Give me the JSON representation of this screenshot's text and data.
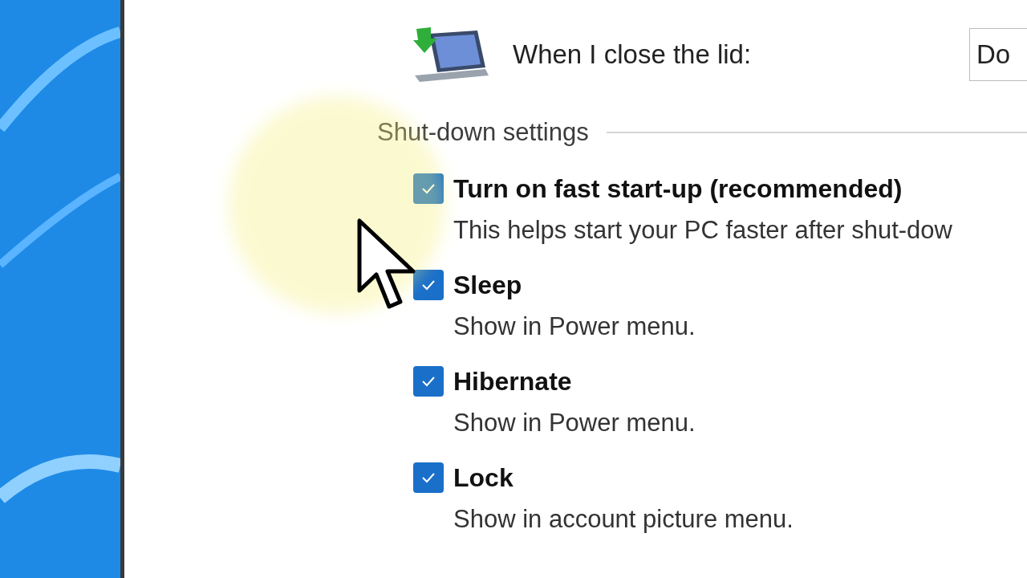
{
  "lid": {
    "label": "When I close the lid:",
    "dropdown_value": "Do"
  },
  "section": {
    "title": "Shut-down settings"
  },
  "options": [
    {
      "label": "Turn on fast start-up (recommended)",
      "description": "This helps start your PC faster after shut-dow",
      "checked": true
    },
    {
      "label": "Sleep",
      "description": "Show in Power menu.",
      "checked": true
    },
    {
      "label": "Hibernate",
      "description": "Show in Power menu.",
      "checked": true
    },
    {
      "label": "Lock",
      "description": "Show in account picture menu.",
      "checked": true
    }
  ]
}
